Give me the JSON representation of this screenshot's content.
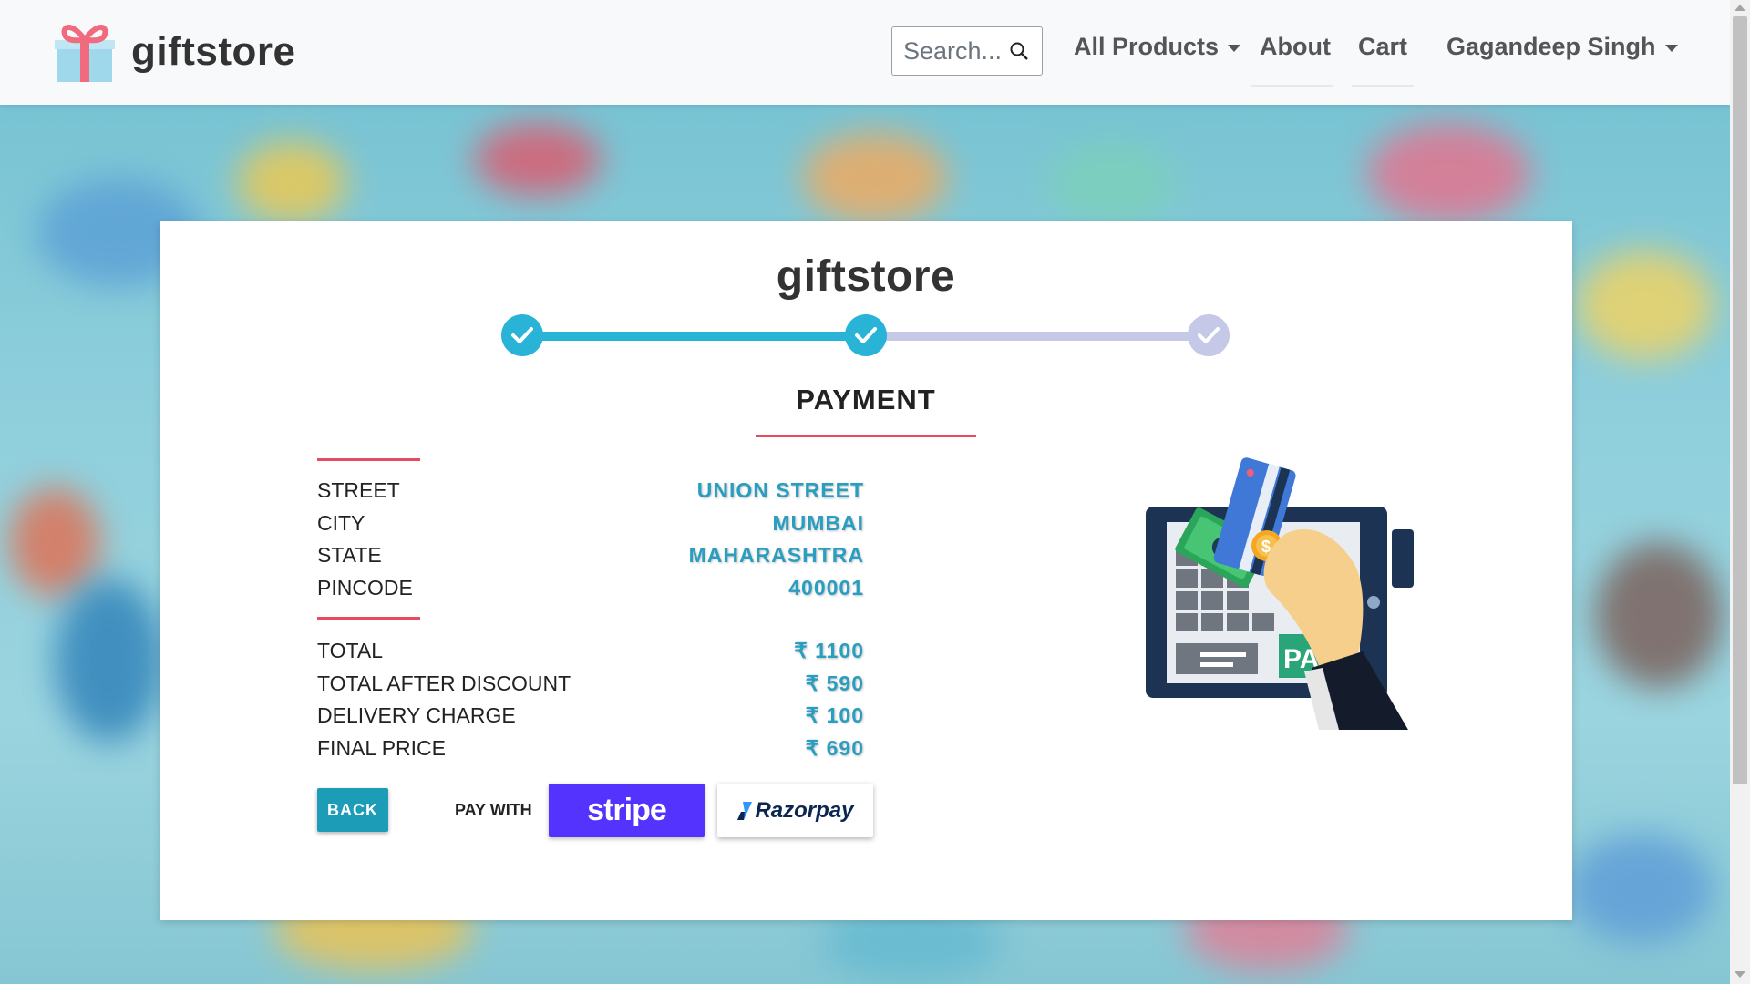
{
  "navbar": {
    "brand": "giftstore",
    "search_placeholder": "Search...",
    "links": {
      "all_products": "All Products",
      "about": "About",
      "cart": "Cart",
      "user": "Gagandeep Singh"
    }
  },
  "card": {
    "title": "giftstore",
    "steps": [
      "completed",
      "completed",
      "pending"
    ],
    "section_title": "PAYMENT",
    "address": [
      {
        "label": "STREET",
        "value": "UNION STREET"
      },
      {
        "label": "CITY",
        "value": "MUMBAI"
      },
      {
        "label": "STATE",
        "value": "MAHARASHTRA"
      },
      {
        "label": "PINCODE",
        "value": "400001"
      }
    ],
    "pricing": [
      {
        "label": "TOTAL",
        "value": "₹ 1100"
      },
      {
        "label": "TOTAL AFTER DISCOUNT",
        "value": "₹ 590"
      },
      {
        "label": "DELIVERY CHARGE",
        "value": "₹ 100"
      },
      {
        "label": "FINAL PRICE",
        "value": "₹ 690"
      }
    ],
    "back_label": "BACK",
    "pay_with_label": "PAY WITH",
    "stripe_label": "stripe",
    "razorpay_label": "Razorpay",
    "illustration_text": "PA"
  },
  "colors": {
    "accent": "#29b3d6",
    "pending_step": "#c5c8e6",
    "underline": "#e84a5f",
    "value_text": "#2a9ec0",
    "stripe": "#5433ff",
    "back_button": "#1d9cb8"
  }
}
